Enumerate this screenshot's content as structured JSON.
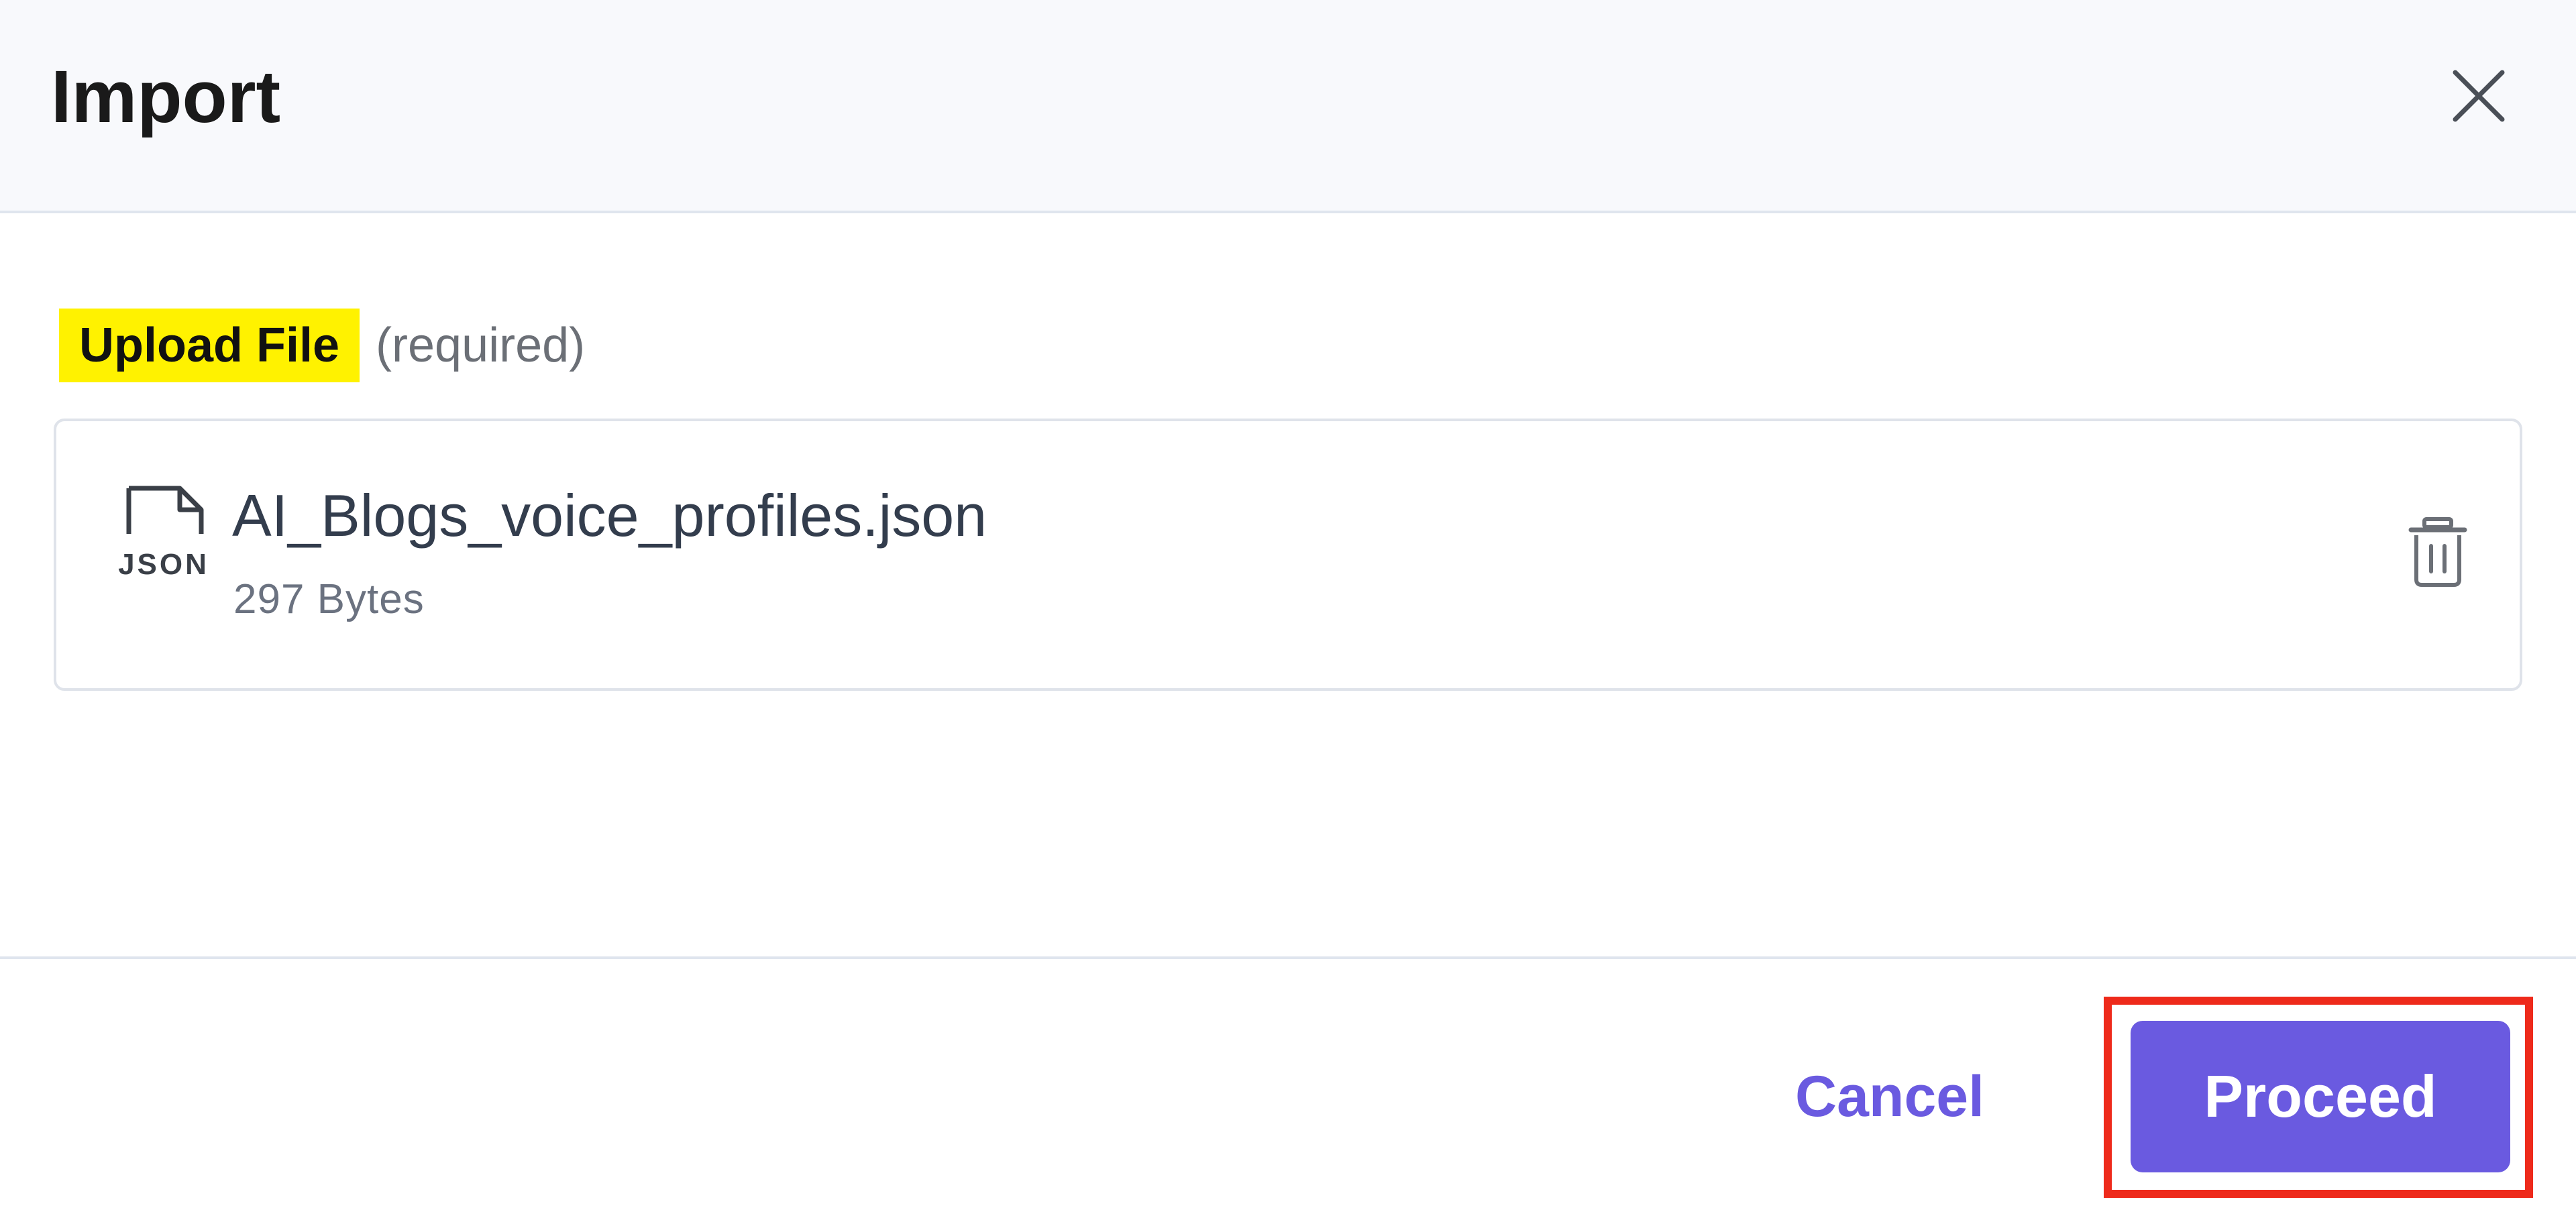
{
  "dialog": {
    "title": "Import"
  },
  "upload": {
    "label": "Upload File",
    "required_text": "(required)"
  },
  "file": {
    "name": "AI_Blogs_voice_profiles.json",
    "size": "297 Bytes",
    "icon": "json-file-icon"
  },
  "footer": {
    "cancel_label": "Cancel",
    "proceed_label": "Proceed"
  },
  "colors": {
    "accent": "#6a5ae0",
    "highlight": "#fff200",
    "annotation_border": "#ee2a1b",
    "header_bg": "#f8f9fc"
  }
}
